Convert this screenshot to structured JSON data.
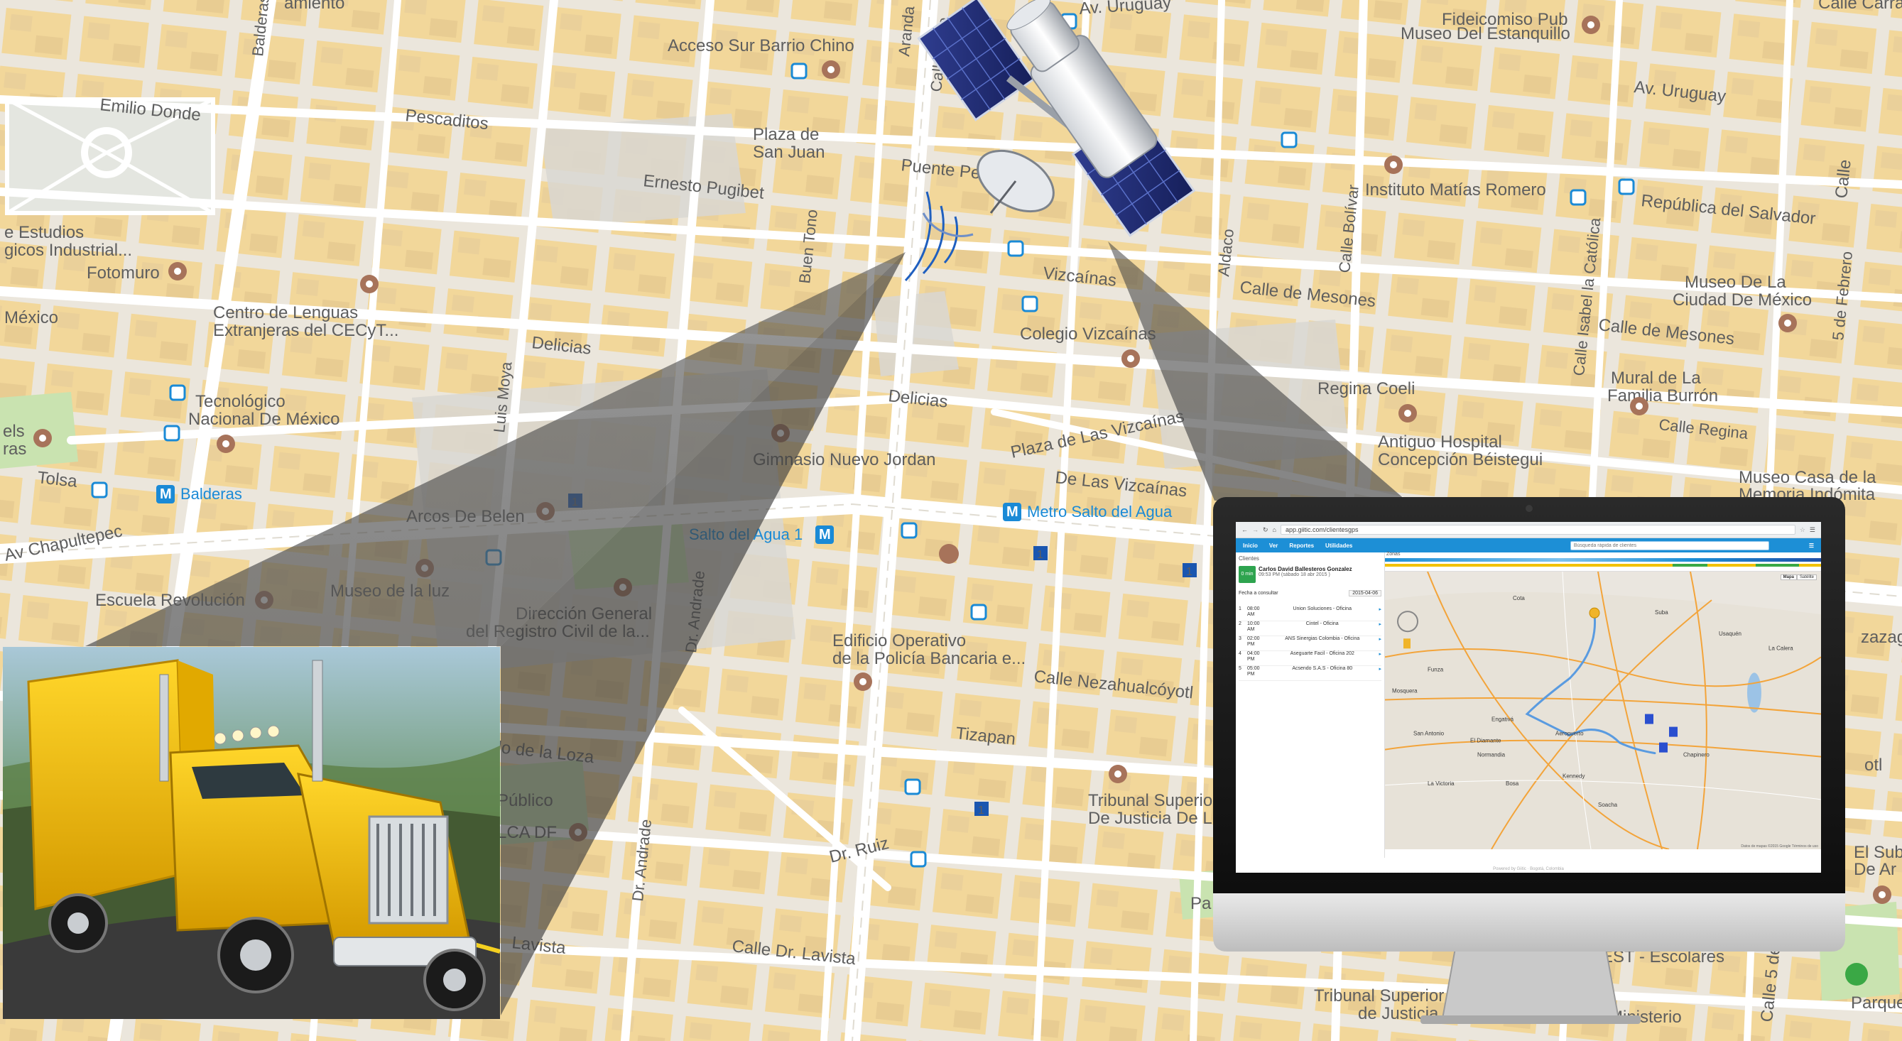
{
  "map": {
    "colors": {
      "land": "#ebe6dc",
      "block": "#f2d79a",
      "gray_block": "#d9d7d2",
      "park": "#c9e3b0",
      "road": "#ffffff",
      "label": "#5e5e5e",
      "transit": "#1a8ad6"
    },
    "street_labels": [
      "Av. Uruguay",
      "Av. Uruguay",
      "Emilio Donde",
      "Pescaditos",
      "Ernesto Pugibet",
      "Delicias",
      "Delicias",
      "Vizcaínas",
      "Calle de Mesones",
      "Calle de Mesones",
      "República del Salvador",
      "Av Chapultepec",
      "Plaza de Las Vizcaínas",
      "De Las Vizcaínas",
      "Calle Nezahualcóyotl",
      "Tizapan",
      "Dr. Ruiz",
      "Calle Dr. Lavista",
      "Lavista",
      "lo de la Loza",
      "Balderas",
      "Aranda",
      "Calle Lópe",
      "Buen Tono",
      "Luis Moya",
      "Dr. Andrade",
      "Dr. Andrade",
      "Aldaco",
      "Calle Bolívar",
      "Calle Isabel la Católica",
      "5 de Febrero",
      "Calle Regina",
      "Tolsa",
      "Puente Pe",
      "Calle 5 de Feb",
      "Calle Carranza",
      "zazaga",
      "otl",
      "Calle",
      "amiento"
    ],
    "poi_labels": [
      "Acceso Sur Barrio Chino",
      "Plaza de",
      "San Juan",
      "Fideicomiso Pub",
      "Museo Del Estanquillo",
      "Instituto Matías Romero",
      "Museo De La",
      "Ciudad De México",
      "Mural de La",
      "Familia Burrón",
      "Regina Coeli",
      "Antiguo Hospital",
      "Concepción Béistegui",
      "Museo Casa de la",
      "Memoria Indómita",
      "Colegio Vizcaínas",
      "Gimnasio Nuevo Jordan",
      "Centro de Lenguas",
      "Extranjeras del CECyT...",
      "Tecnológico",
      "Nacional De México",
      "Fotomuro",
      "México",
      "e Estudios",
      "gicos Industrial...",
      "Arcos De Belen",
      "Museo de la luz",
      "Escuela Revolución",
      "Dirección General",
      "del Registro Civil de la...",
      "Edificio Operativo",
      "de la Policía Bancaria e...",
      "Tribunal Superior",
      "De Justicia De L",
      "Tribunal Superior",
      "de Justicia",
      "Público",
      "LCA DF",
      "Parque",
      "El Sub",
      "De Ar",
      "EST - Escolares",
      "Ministerio",
      "els",
      "ras",
      "Pa"
    ],
    "transit_labels": [
      "Balderas",
      "Metro Salto del Agua",
      "Salto del Agua 1"
    ],
    "route_badges": [
      "1",
      "1",
      "1",
      "1"
    ]
  },
  "monitor": {
    "url": "app.giitic.com/clientesgps",
    "nav": [
      "Inicio",
      "Ver",
      "Reportes",
      "Utilidades"
    ],
    "search_placeholder": "Búsqueda rápida de clientes",
    "sidebar_title": "Clientes",
    "zones_label": "Zonas",
    "driver_name": "Carlos David Ballesteros Gonzalez",
    "driver_time": "09:53 PM (sábado 18 abr 2015 )",
    "status_badge": "0 min",
    "date_label": "Fecha a consultar",
    "date_value": "2015-04-06",
    "map_types": [
      "Mapa",
      "Satélite"
    ],
    "visits": [
      {
        "n": "1",
        "time": "08:00 AM",
        "place": "Union Soluciones - Oficina"
      },
      {
        "n": "2",
        "time": "10:00 AM",
        "place": "Cintel - Oficina"
      },
      {
        "n": "3",
        "time": "02:00 PM",
        "place": "ANS Sinergias Colombia - Oficina"
      },
      {
        "n": "4",
        "time": "04:00 PM",
        "place": "Aseguarte Facil - Oficina 202"
      },
      {
        "n": "5",
        "time": "05:00 PM",
        "place": "Acsendo S.A.S - Oficina 80"
      }
    ],
    "map_places": [
      "Cota",
      "Funza",
      "Mosquera",
      "Suba",
      "Usaquén",
      "La Calera",
      "Soacha",
      "Bosa",
      "Kennedy",
      "Engativá",
      "Chapinero",
      "San Antonio",
      "El Diamante",
      "Normandia",
      "La Victoria",
      "Aeropuerto"
    ],
    "footer": "Powered by Giitic · Bogotá, Colombia",
    "map_footer": "Datos de mapas ©2015 Google   Términos de uso"
  }
}
